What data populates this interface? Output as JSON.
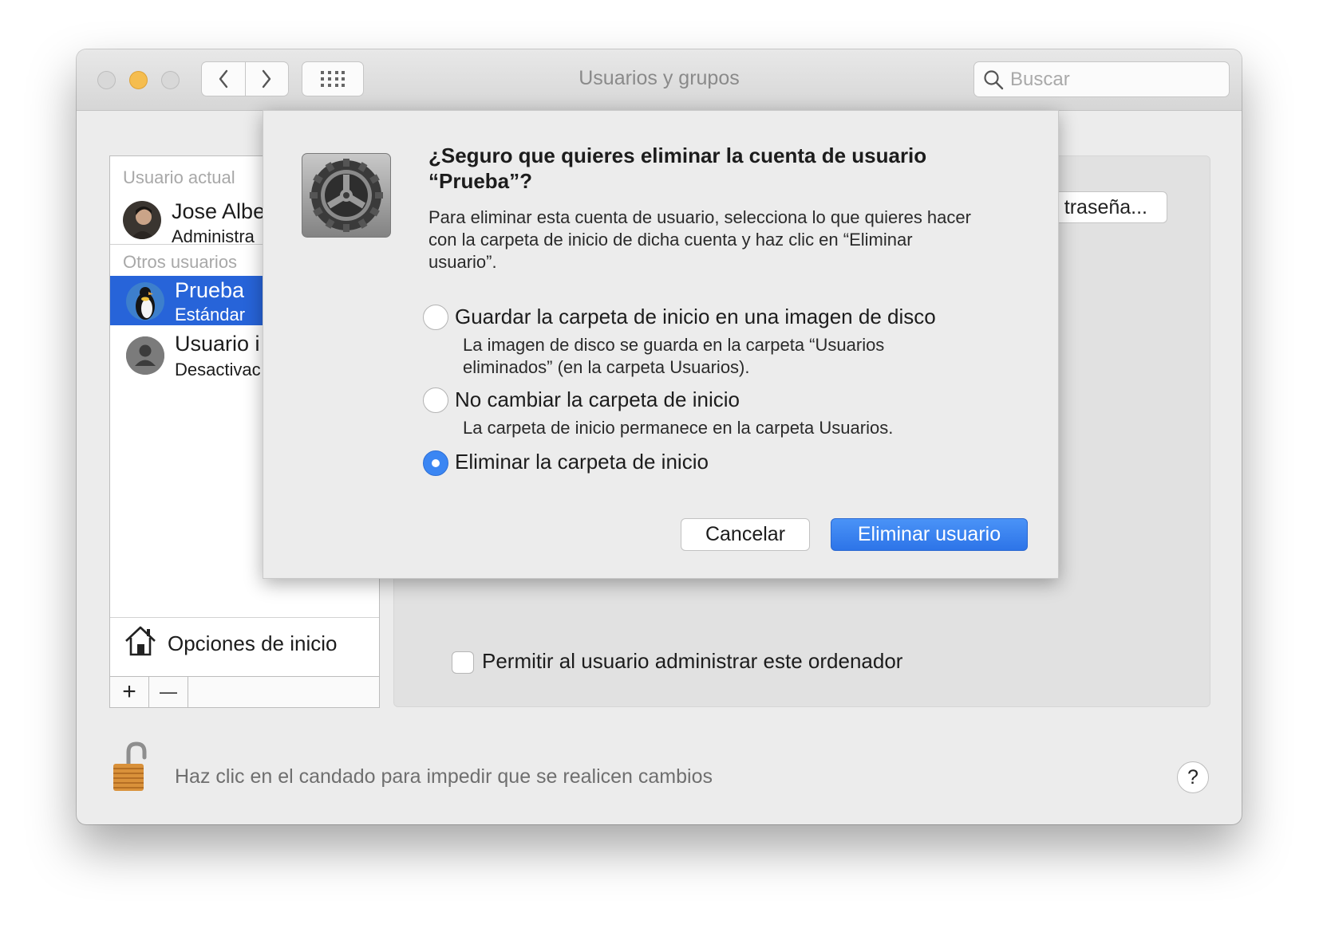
{
  "window": {
    "title": "Usuarios y grupos",
    "search_placeholder": "Buscar"
  },
  "users": {
    "current_header": "Usuario actual",
    "current_user": {
      "name": "Jose Albe",
      "role": "Administra"
    },
    "others_header": "Otros usuarios",
    "others": [
      {
        "name": "Prueba",
        "role": "Estándar",
        "selected": true
      },
      {
        "name": "Usuario i",
        "role": "Desactivac",
        "selected": false
      }
    ],
    "options_label": "Opciones de inicio",
    "add_label": "+",
    "remove_label": "—"
  },
  "detail": {
    "password_button": "traseña...",
    "admin_checkbox_label": "Permitir al usuario administrar este ordenador",
    "admin_checked": false
  },
  "footer": {
    "lock_text": "Haz clic en el candado para impedir que se realicen cambios",
    "help_label": "?"
  },
  "dialog": {
    "title_line1": "¿Seguro que quieres eliminar la cuenta de usuario",
    "title_line2": "“Prueba”?",
    "body_line1": "Para eliminar esta cuenta de usuario, selecciona lo que quieres hacer",
    "body_line2": "con la carpeta de inicio de dicha cuenta y haz clic en “Eliminar",
    "body_line3": "usuario”.",
    "options": [
      {
        "label": "Guardar la carpeta de inicio en una imagen de disco",
        "desc_line1": "La imagen de disco se guarda en la carpeta “Usuarios",
        "desc_line2": "eliminados” (en la carpeta Usuarios).",
        "selected": false
      },
      {
        "label": "No cambiar la carpeta de inicio",
        "desc_line1": "La carpeta de inicio permanece en la carpeta Usuarios.",
        "desc_line2": "",
        "selected": false
      },
      {
        "label": "Eliminar la carpeta de inicio",
        "desc_line1": "",
        "desc_line2": "",
        "selected": true
      }
    ],
    "cancel_label": "Cancelar",
    "confirm_label": "Eliminar usuario"
  },
  "colors": {
    "accent": "#2764d9",
    "primary_button": "#3b84f2",
    "minimize_light": "#f5bd4f"
  },
  "icons": [
    "back-icon",
    "forward-icon",
    "grid-icon",
    "search-icon",
    "house-icon",
    "gear-icon",
    "lock-icon"
  ]
}
